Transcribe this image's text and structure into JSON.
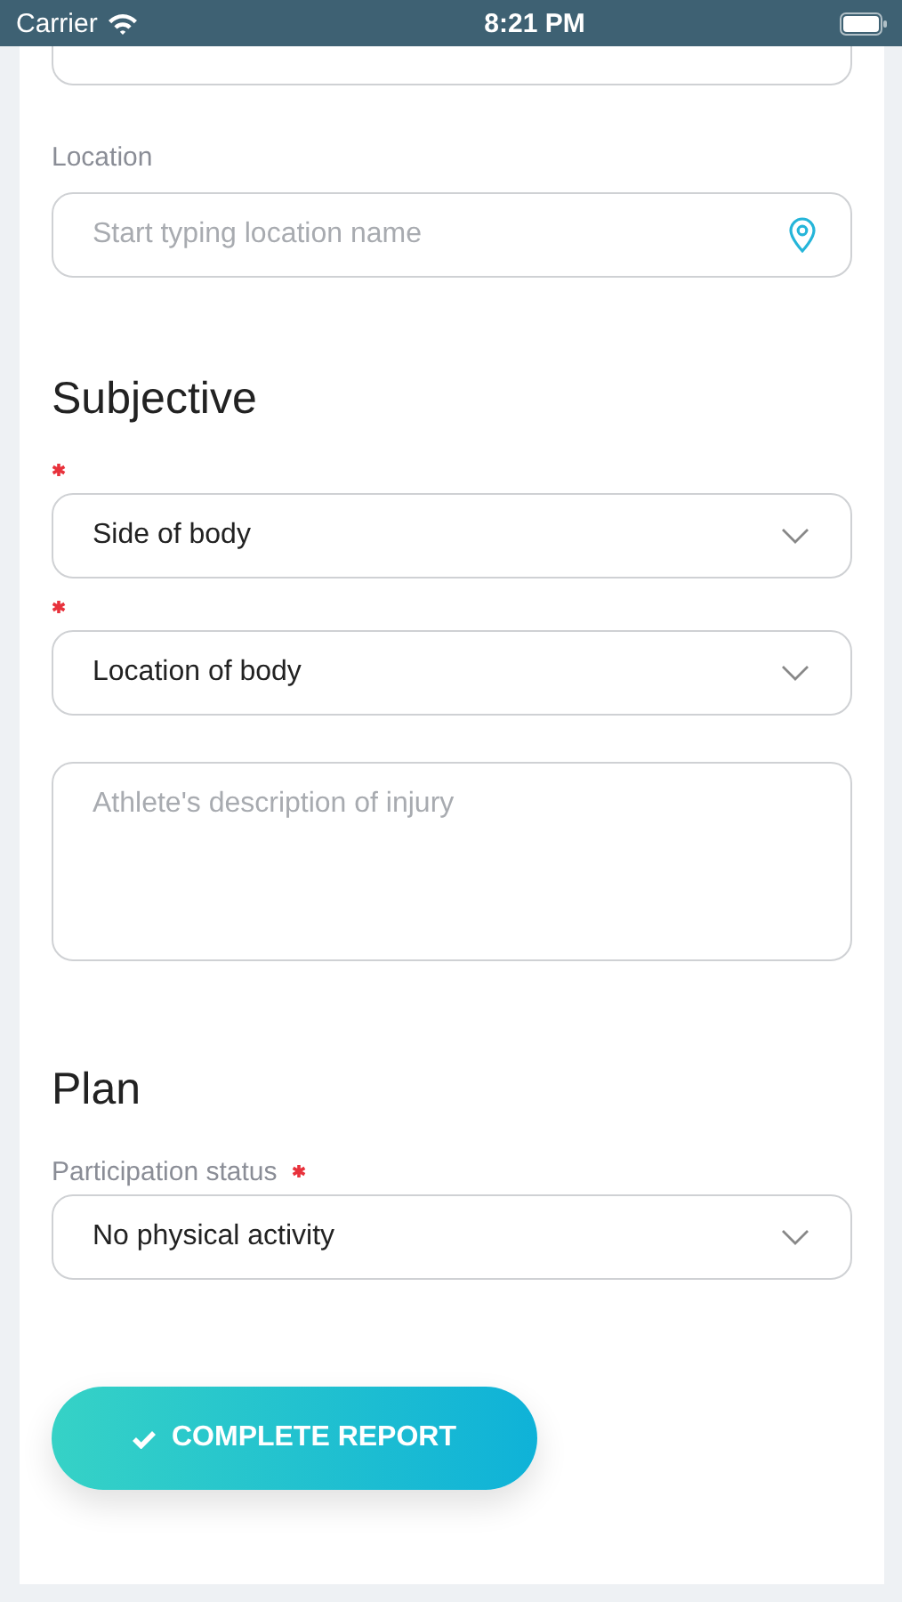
{
  "status_bar": {
    "carrier": "Carrier",
    "time": "8:21 PM"
  },
  "form": [
    {
      "kind": "stub"
    },
    {
      "kind": "input",
      "label": "Location",
      "placeholder": "Start typing location name"
    },
    {
      "kind": "heading",
      "text": "Subjective"
    },
    {
      "kind": "select",
      "value": "Side of body",
      "required": true
    },
    {
      "kind": "select",
      "value": "Location of body",
      "required": true
    },
    {
      "kind": "textarea",
      "placeholder": "Athlete's description of injury"
    },
    {
      "kind": "heading",
      "text": "Plan"
    },
    {
      "kind": "select",
      "label": "Participation status",
      "value": "No physical activity",
      "required": true
    }
  ],
  "submit": {
    "label": "COMPLETE REPORT"
  }
}
